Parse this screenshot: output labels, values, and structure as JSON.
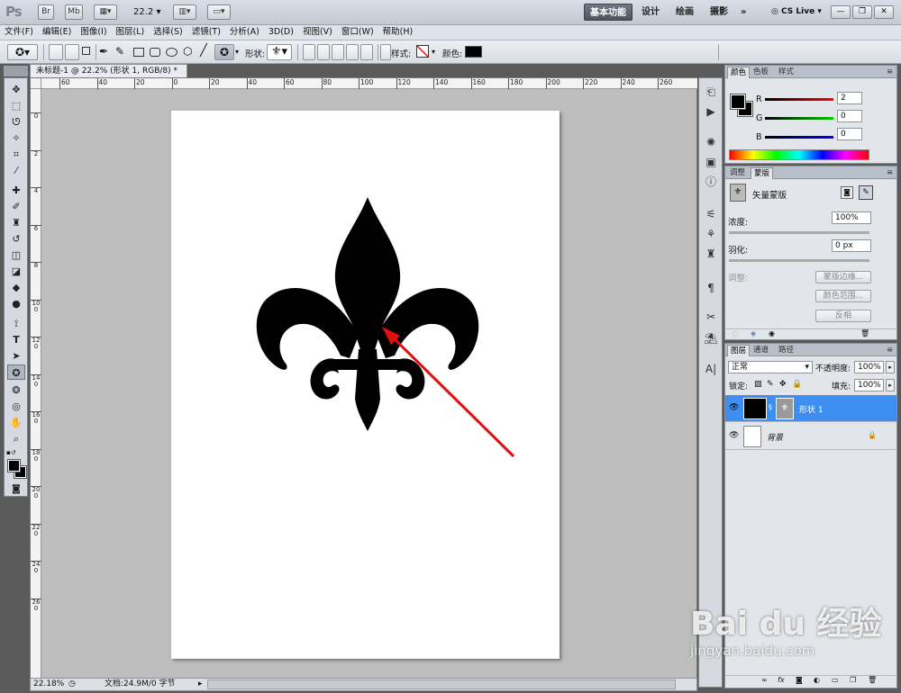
{
  "app": {
    "logo": "Ps",
    "bridge_label": "Br",
    "minibridge_label": "Mb",
    "zoom_value": "22.2"
  },
  "workspaces": [
    "基本功能",
    "设计",
    "绘画",
    "摄影"
  ],
  "more_label": "»",
  "cs_live": "CS Live",
  "menu": [
    "文件(F)",
    "编辑(E)",
    "图像(I)",
    "图层(L)",
    "选择(S)",
    "滤镜(T)",
    "分析(A)",
    "3D(D)",
    "视图(V)",
    "窗口(W)",
    "帮助(H)"
  ],
  "options": {
    "shape_label": "形状:",
    "style_label": "样式:",
    "color_label": "颜色:",
    "color_value": "#000000"
  },
  "document": {
    "tab_title": "未标题-1 @ 22.2% (形状 1, RGB/8) *",
    "close": "✕"
  },
  "ruler": {
    "h": [
      "60",
      "40",
      "20",
      "0",
      "20",
      "40",
      "60",
      "80",
      "100",
      "120",
      "140",
      "160",
      "180",
      "200",
      "220",
      "240",
      "260"
    ],
    "v": [
      "0",
      "2",
      "4",
      "6",
      "8",
      "100",
      "120",
      "140",
      "160",
      "180",
      "200",
      "220",
      "240",
      "260"
    ]
  },
  "status": {
    "zoom": "22.18%",
    "doc_info": "文档:24.9M/0 字节"
  },
  "color_panel": {
    "tabs": [
      "颜色",
      "色板",
      "样式"
    ],
    "channels": [
      {
        "name": "R",
        "value": "2"
      },
      {
        "name": "G",
        "value": "0"
      },
      {
        "name": "B",
        "value": "0"
      }
    ]
  },
  "mask_panel": {
    "tabs": [
      "调整",
      "蒙版"
    ],
    "mask_type": "矢量蒙版",
    "density_label": "浓度:",
    "density_value": "100%",
    "feather_label": "羽化:",
    "feather_value": "0 px",
    "refine_label": "调整:",
    "mask_edge_btn": "蒙版边缘...",
    "color_range_btn": "颜色范围...",
    "invert_btn": "反相"
  },
  "layers_panel": {
    "tabs": [
      "图层",
      "通道",
      "路径"
    ],
    "blend_mode": "正常",
    "opacity_label": "不透明度:",
    "opacity_value": "100%",
    "lock_label": "锁定:",
    "fill_label": "填充:",
    "fill_value": "100%",
    "layers": [
      {
        "name": "形状 1",
        "selected": true
      },
      {
        "name": "背景",
        "selected": false
      }
    ]
  },
  "watermark": {
    "brand": "Bai du 经验",
    "url": "jingyan.baidu.com"
  }
}
